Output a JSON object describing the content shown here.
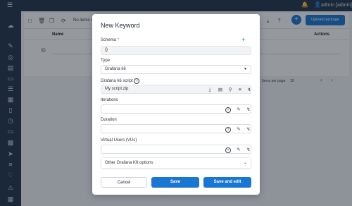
{
  "topbar": {
    "user_label": "admin [admin]",
    "menu_icon": "menu-icon",
    "bell_icon": "bell-icon",
    "user_icon": "user-icon"
  },
  "background": {
    "no_items_label": "No items s",
    "name_header": "Name",
    "actions_header": "Actions",
    "upload_label": "Upload package",
    "items_per_page_label": "Items per page",
    "items_per_page_value": "10"
  },
  "modal": {
    "title": "New Keyword",
    "schema": {
      "label": "Schema",
      "required_mark": "*",
      "value": "{}"
    },
    "type": {
      "label": "Type",
      "value": "Grafana k6"
    },
    "script": {
      "label": "Grafana k6 script",
      "value": "My script.zip"
    },
    "iterations": {
      "label": "Iterations",
      "value": ""
    },
    "duration": {
      "label": "Duration",
      "value": ""
    },
    "vus": {
      "label": "Virtual Users (VUs)",
      "value": ""
    },
    "other_options": {
      "label": "Other Grafana K6 options"
    },
    "buttons": {
      "cancel": "Cancel",
      "save": "Save",
      "save_edit": "Save and edit"
    }
  },
  "colors": {
    "primary": "#1976d2",
    "sidebar": "#1f3247",
    "overlay": "rgba(20,28,40,0.45)"
  }
}
